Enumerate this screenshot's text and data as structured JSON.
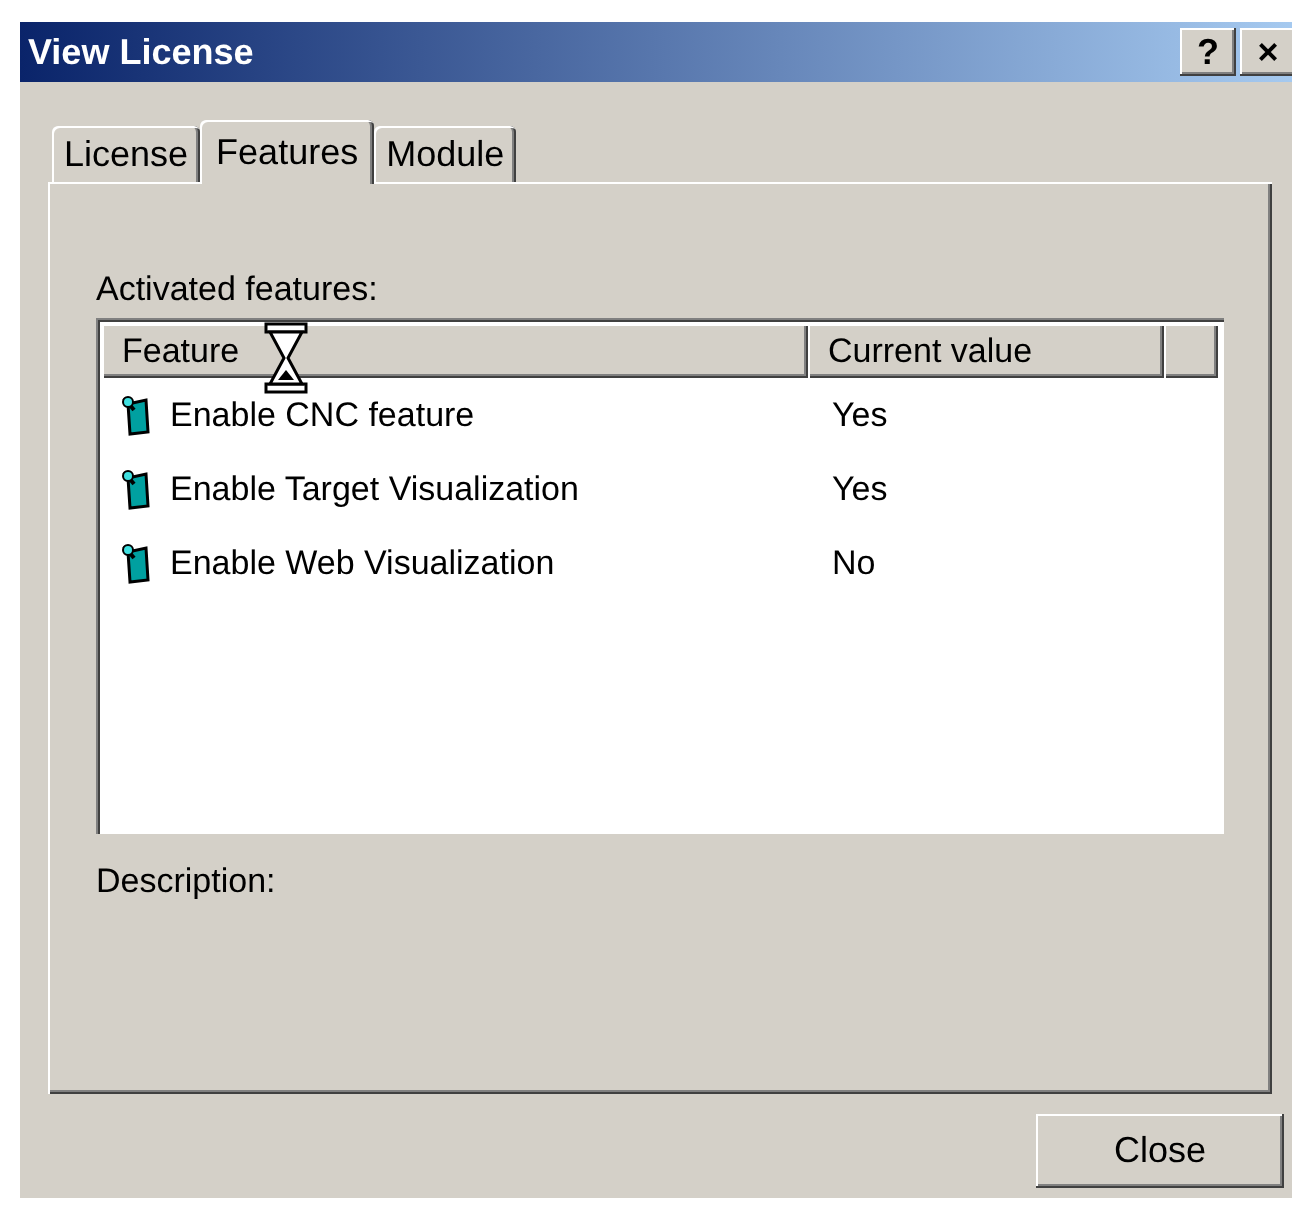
{
  "window": {
    "title": "View License",
    "buttons": [
      "?",
      "×"
    ]
  },
  "tabs": [
    {
      "label": "License",
      "selected": false
    },
    {
      "label": "Features",
      "selected": true
    },
    {
      "label": "Module",
      "selected": false
    }
  ],
  "features_label": "Activated features:",
  "table": {
    "columns": [
      "Feature",
      "Current value"
    ],
    "rows": [
      {
        "feature": "Enable CNC feature",
        "value": "Yes"
      },
      {
        "feature": "Enable Target Visualization",
        "value": "Yes"
      },
      {
        "feature": "Enable Web Visualization",
        "value": "No"
      }
    ]
  },
  "description_label": "Description:",
  "close_button": "Close"
}
